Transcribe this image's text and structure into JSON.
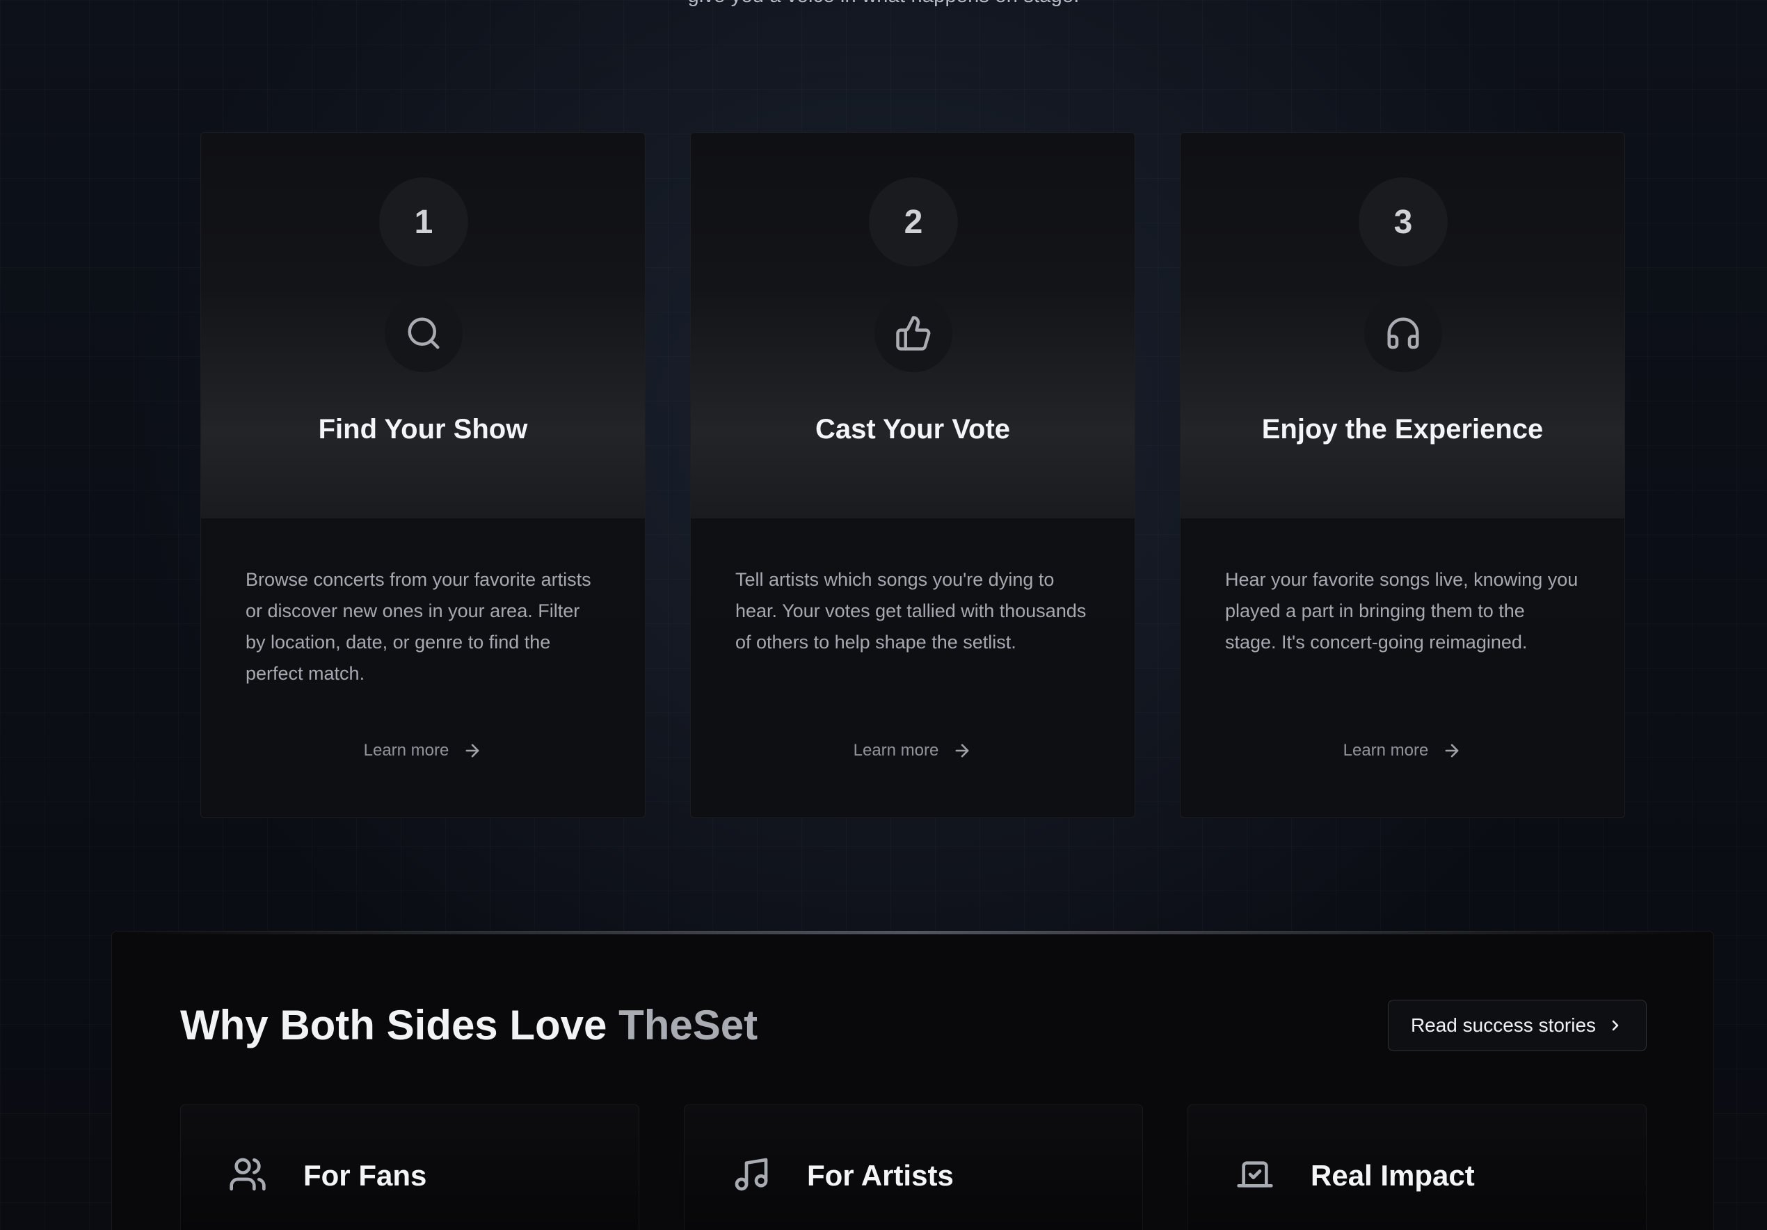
{
  "intro": {
    "text": "give you a voice in what happens on stage."
  },
  "steps": [
    {
      "number": "1",
      "icon": "search-icon",
      "title": "Find Your Show",
      "body": "Browse concerts from your favorite artists or discover new ones in your area. Filter by location, date, or genre to find the perfect match.",
      "link": "Learn more"
    },
    {
      "number": "2",
      "icon": "thumbs-up-icon",
      "title": "Cast Your Vote",
      "body": "Tell artists which songs you're dying to hear. Your votes get tallied with thousands of others to help shape the setlist.",
      "link": "Learn more"
    },
    {
      "number": "3",
      "icon": "headphones-icon",
      "title": "Enjoy the Experience",
      "body": "Hear your favorite songs live, knowing you played a part in bringing them to the stage. It's concert-going reimagined.",
      "link": "Learn more"
    }
  ],
  "why": {
    "title_main": "Why Both Sides Love ",
    "title_accent": "TheSet",
    "button": "Read success stories",
    "features": [
      {
        "icon": "users-icon",
        "title": "For Fans"
      },
      {
        "icon": "music-note-icon",
        "title": "For Artists"
      },
      {
        "icon": "vote-box-icon",
        "title": "Real Impact"
      }
    ]
  },
  "colors": {
    "background": "#0c0f16",
    "card": "#0f1014",
    "text_primary": "#f4f5f7",
    "text_muted": "#a6a9b1",
    "accent_gray": "#a9acb2"
  }
}
